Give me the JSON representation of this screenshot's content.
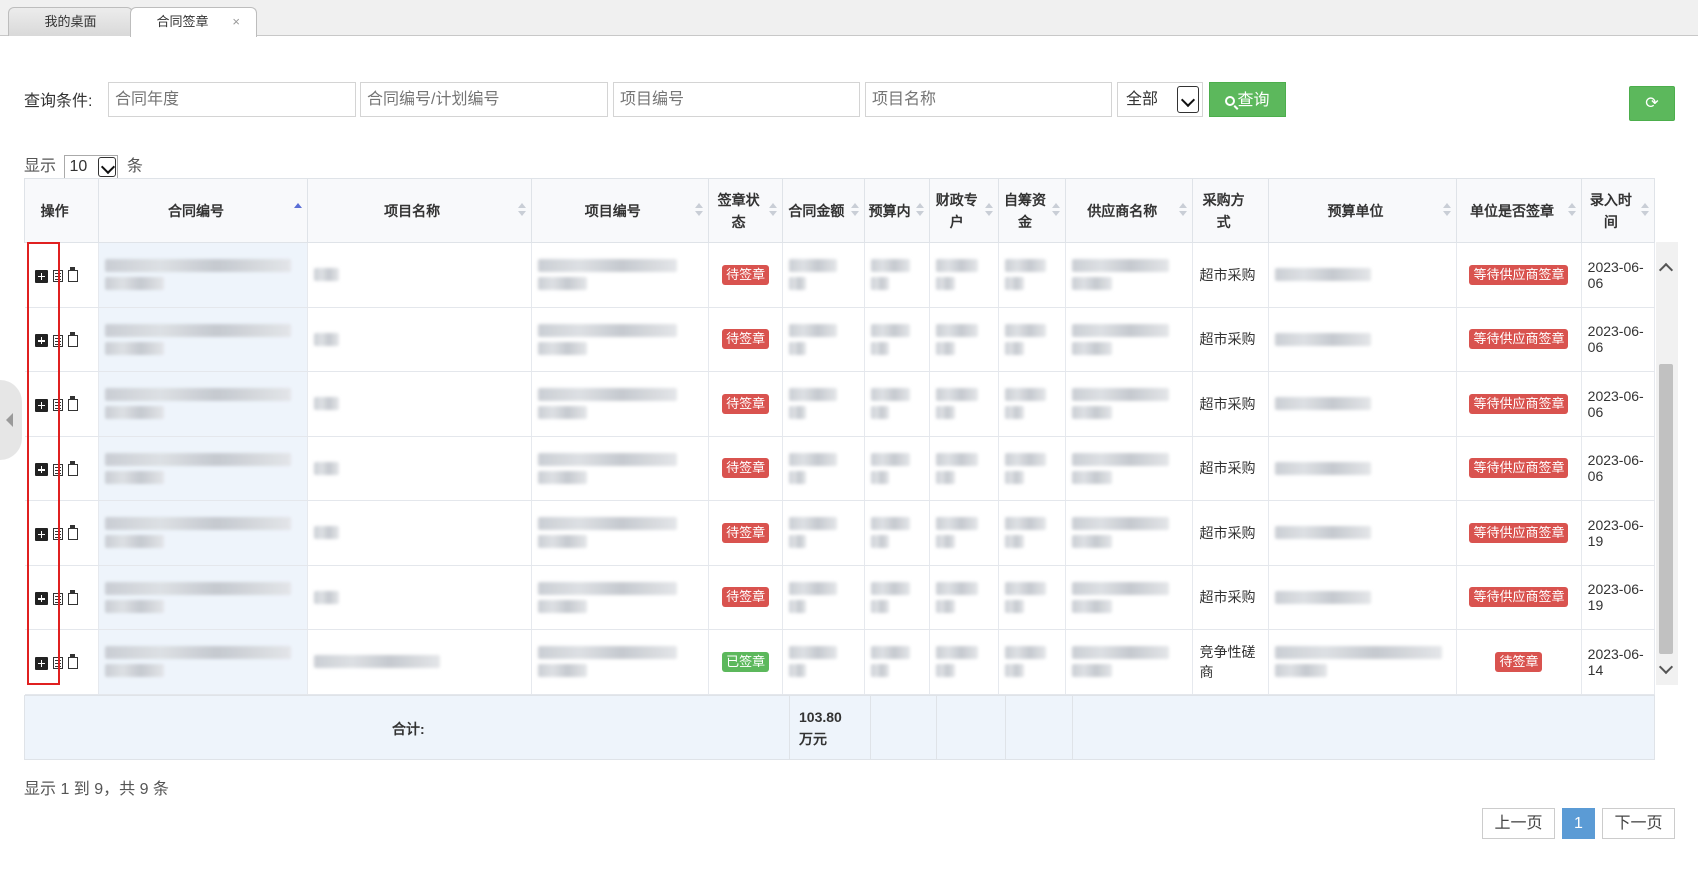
{
  "tabs": [
    {
      "label": "我的桌面"
    },
    {
      "label": "合同签章",
      "close": "×"
    }
  ],
  "query": {
    "label": "查询条件:",
    "placeholders": {
      "year": "合同年度",
      "contract_no": "合同编号/计划编号",
      "project_no": "项目编号",
      "project_name": "项目名称"
    },
    "status_value": "全部",
    "search_label": "查询"
  },
  "page_size": {
    "prefix": "显示",
    "value": "10",
    "suffix": "条"
  },
  "table": {
    "headers": [
      "操作",
      "合同编号",
      "项目名称",
      "项目编号",
      "签章状态",
      "合同金额",
      "预算内",
      "财政专户",
      "自筹资金",
      "供应商名称",
      "采购方式",
      "预算单位",
      "单位是否签章",
      "录入时间"
    ],
    "rows": [
      {
        "status": "待签章",
        "status_color": "red",
        "method": "超市采购",
        "unit_sign": "等待供应商签章",
        "date": "2023-06-06"
      },
      {
        "status": "待签章",
        "status_color": "red",
        "method": "超市采购",
        "unit_sign": "等待供应商签章",
        "date": "2023-06-06"
      },
      {
        "status": "待签章",
        "status_color": "red",
        "method": "超市采购",
        "unit_sign": "等待供应商签章",
        "date": "2023-06-06"
      },
      {
        "status": "待签章",
        "status_color": "red",
        "method": "超市采购",
        "unit_sign": "等待供应商签章",
        "date": "2023-06-06"
      },
      {
        "status": "待签章",
        "status_color": "red",
        "method": "超市采购",
        "unit_sign": "等待供应商签章",
        "date": "2023-06-19"
      },
      {
        "status": "待签章",
        "status_color": "red",
        "method": "超市采购",
        "unit_sign": "等待供应商签章",
        "date": "2023-06-19"
      },
      {
        "status": "已签章",
        "status_color": "green",
        "method": "竞争性磋商",
        "unit_sign": "待签章",
        "date": "2023-06-14"
      }
    ],
    "totals_label": "合计:",
    "totals_amount": "103.80 万元"
  },
  "summary": "显示 1 到 9，共 9 条",
  "pager": {
    "prev": "上一页",
    "current": "1",
    "next": "下一页"
  },
  "colors": {
    "accent_green": "#5cb85c",
    "badge_red": "#d9534f",
    "active_page": "#5b9bd5",
    "highlight_box": "#e02020"
  }
}
